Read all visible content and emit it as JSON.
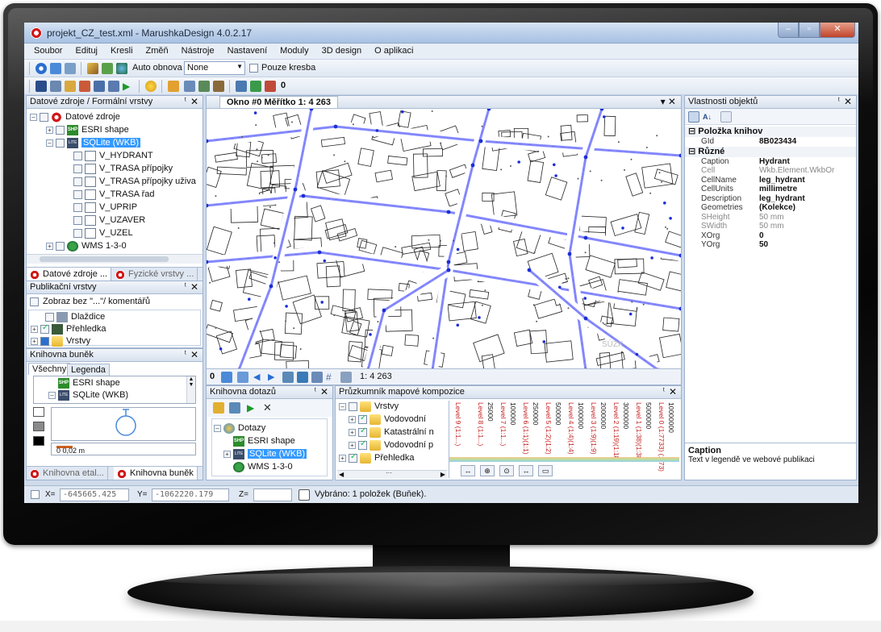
{
  "window": {
    "title": "projekt_CZ_test.xml - MarushkaDesign 4.0.2.17",
    "btn_min": "–",
    "btn_max": "▫",
    "btn_close": "✕"
  },
  "menu": [
    "Soubor",
    "Edituj",
    "Kresli",
    "Změň",
    "Nástroje",
    "Nastavení",
    "Moduly",
    "3D design",
    "O aplikaci"
  ],
  "toolbar": {
    "auto_label": "Auto obnova",
    "combo_value": "None",
    "only_drawing_label": "Pouze kresba",
    "counter": "0"
  },
  "sources_panel": {
    "title": "Datové zdroje / Formální vrstvy",
    "root": "Datové zdroje",
    "items": [
      "ESRI shape",
      "SQLite (WKB)",
      "WMS 1-3-0"
    ],
    "layers": [
      "V_HYDRANT",
      "V_TRASA přípojky",
      "V_TRASA přípojky uživa",
      "V_TRASA řad",
      "V_UPRIP",
      "V_UZAVER",
      "V_UZEL"
    ],
    "tab1": "Datové zdroje ...",
    "tab2": "Fyzické vrstvy ..."
  },
  "publication_panel": {
    "title": "Publikační vrstvy",
    "filter_label": "Zobraz bez \"...\"/ komentářů",
    "items": [
      "Dlaždice",
      "Přehledka",
      "Vrstvy"
    ]
  },
  "cells_panel": {
    "title": "Knihovna buněk",
    "tab_all": "Všechny",
    "tab_legend": "Legenda",
    "items": [
      "ESRI shape",
      "SQLite (WKB)"
    ],
    "scale_label": "0   0,02 m",
    "tab1": "Knihovna etal...",
    "tab2": "Knihovna buněk"
  },
  "map": {
    "tab_title": "Okno #0 Měřítko 1:  4 263",
    "scale_text": "1:  4 263",
    "zero": "0",
    "watermark": "SÚZK",
    "colors": {
      "road": "#6f74ff",
      "node": "#1b2fd6",
      "building": "#222222",
      "orange": "#f2a85c"
    }
  },
  "queries_panel": {
    "title": "Knihovna dotazů",
    "root": "Dotazy",
    "items": [
      "ESRI shape",
      "SQLite (WKB)",
      "WMS 1-3-0"
    ]
  },
  "composition_panel": {
    "title": "Průzkumník mapové kompozice",
    "items": [
      "Vrstvy",
      "Vodovodní",
      "Katastrální n",
      "Vodovodní p",
      "Přehledka"
    ],
    "scale_cols": [
      "10000000",
      "5000000",
      "3000000",
      "2000000",
      "1000000",
      "500000",
      "250000",
      "100000",
      "25000"
    ],
    "level_cols": [
      "Level 0 (1:7733) (1:73)",
      "Level 1 (1:38)(1:38)",
      "Level 2 (1:19)(1:18)",
      "Level 3 (1:9)(1:9)",
      "Level 4 (1:4)(1:4)",
      "Level 5 (1:2)(1:2)",
      "Level 6 (1:1)(1:1)",
      "Level 7 (1:1...)",
      "Level 8 (1:1...)",
      "Level 9 (1:1...)"
    ]
  },
  "properties_panel": {
    "title": "Vlastnosti objektů",
    "cat1": "Položka knihov",
    "cat2": "Různé",
    "rows": [
      {
        "k": "GId",
        "v": "8B023434",
        "dim": false
      },
      {
        "k": "Caption",
        "v": "Hydrant",
        "dim": false
      },
      {
        "k": "Cell",
        "v": "Wkb.Element.WkbOr",
        "dim": true
      },
      {
        "k": "CellName",
        "v": "leg_hydrant",
        "dim": false
      },
      {
        "k": "CellUnits",
        "v": "millimetre",
        "dim": false
      },
      {
        "k": "Description",
        "v": "leg_hydrant",
        "dim": false
      },
      {
        "k": "Geometries",
        "v": "(Kolekce)",
        "dim": false
      },
      {
        "k": "SHeight",
        "v": "50 mm",
        "dim": true
      },
      {
        "k": "SWidth",
        "v": "50 mm",
        "dim": true
      },
      {
        "k": "XOrg",
        "v": "0",
        "dim": false
      },
      {
        "k": "YOrg",
        "v": "50",
        "dim": false
      }
    ],
    "desc_title": "Caption",
    "desc_text": "Text v legendě ve webové publikaci"
  },
  "status": {
    "x_label": "X=",
    "x_value": "-645665.425",
    "y_label": "Y=",
    "y_value": "-1062220.179",
    "z_label": "Z=",
    "z_value": "",
    "selection": "Vybráno: 1  položek (Buňek)."
  }
}
